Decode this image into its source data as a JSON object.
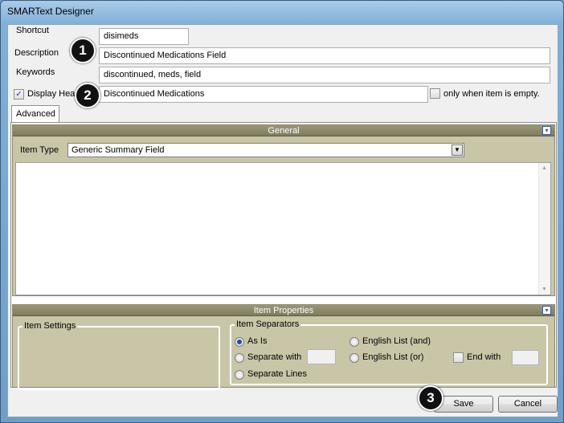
{
  "window": {
    "title": "SMARText Designer"
  },
  "form": {
    "shortcut_label": "Shortcut",
    "shortcut_value": "disimeds",
    "description_label": "Description",
    "description_value": "Discontinued Medications Field",
    "keywords_label": "Keywords",
    "keywords_value": "discontinued, meds, field",
    "display_header_label": "Display Hea",
    "display_header_checked": true,
    "header_value": "Discontinued Medications",
    "only_when_empty_label": "only when item is empty.",
    "only_when_empty_checked": false
  },
  "tabs": [
    {
      "label": "Advanced",
      "active": true
    }
  ],
  "general": {
    "title": "General",
    "item_type_label": "Item Type",
    "item_type_value": "Generic Summary Field"
  },
  "item_properties": {
    "title": "Item Properties",
    "item_settings_legend": "Item Settings",
    "separators_legend": "Item Separators",
    "options": {
      "as_is": "As Is",
      "separate_with": "Separate with",
      "separate_lines": "Separate Lines",
      "english_list_and": "English List (and)",
      "english_list_or": "English List (or)"
    },
    "selected": "as_is",
    "end_with_label": "End with",
    "end_with_checked": false
  },
  "callouts": [
    "1",
    "2",
    "3"
  ],
  "footer": {
    "save_label": "Save",
    "cancel_label": "Cancel"
  },
  "icons": {
    "checkmark": "checkmark-icon",
    "dropdown": "chevron-down-icon",
    "collapse": "collapse-icon",
    "scroll_up": "scroll-up-arrow-icon",
    "scroll_down": "scroll-down-arrow-icon"
  }
}
